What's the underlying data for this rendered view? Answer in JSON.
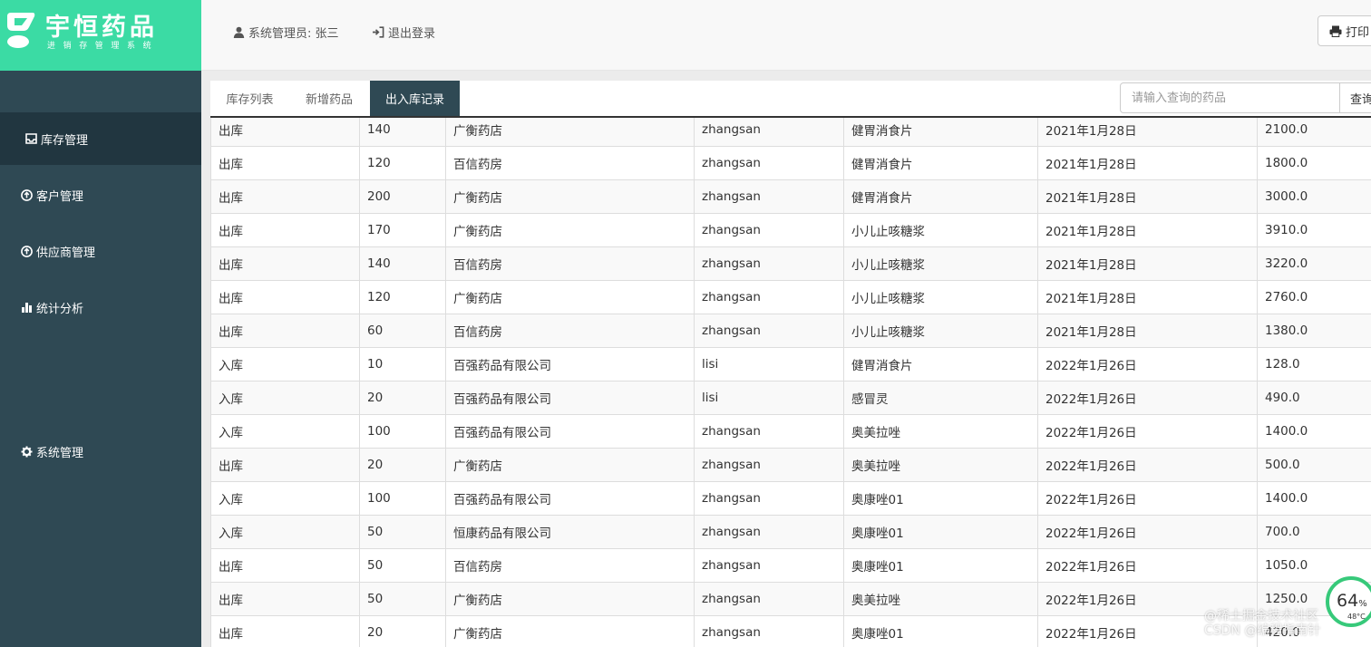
{
  "logo": {
    "title": "宇恒药品",
    "subtitle": "进销存管理系统"
  },
  "sidebar": {
    "items": [
      {
        "label": "库存管理",
        "icon": "inbox-icon",
        "active": true
      },
      {
        "label": "客户管理",
        "icon": "circle-arrow-icon"
      },
      {
        "label": "供应商管理",
        "icon": "circle-arrow-icon"
      },
      {
        "label": "统计分析",
        "icon": "bar-chart-icon"
      },
      {
        "label": "系统管理",
        "icon": "gear-icon"
      }
    ]
  },
  "header": {
    "user_label": "系统管理员: 张三",
    "logout_label": "退出登录",
    "print_label": "打印"
  },
  "tabs": [
    {
      "label": "库存列表"
    },
    {
      "label": "新增药品"
    },
    {
      "label": "出入库记录",
      "active": true
    }
  ],
  "search": {
    "placeholder": "请输入查询的药品",
    "button_label": "查询"
  },
  "table": {
    "rows": [
      [
        "出库",
        "140",
        "广衡药店",
        "zhangsan",
        "健胃消食片",
        "2021年1月28日",
        "2100.0"
      ],
      [
        "出库",
        "120",
        "百信药房",
        "zhangsan",
        "健胃消食片",
        "2021年1月28日",
        "1800.0"
      ],
      [
        "出库",
        "200",
        "广衡药店",
        "zhangsan",
        "健胃消食片",
        "2021年1月28日",
        "3000.0"
      ],
      [
        "出库",
        "170",
        "广衡药店",
        "zhangsan",
        "小儿止咳糖浆",
        "2021年1月28日",
        "3910.0"
      ],
      [
        "出库",
        "140",
        "百信药房",
        "zhangsan",
        "小儿止咳糖浆",
        "2021年1月28日",
        "3220.0"
      ],
      [
        "出库",
        "120",
        "广衡药店",
        "zhangsan",
        "小儿止咳糖浆",
        "2021年1月28日",
        "2760.0"
      ],
      [
        "出库",
        "60",
        "百信药房",
        "zhangsan",
        "小儿止咳糖浆",
        "2021年1月28日",
        "1380.0"
      ],
      [
        "入库",
        "10",
        "百强药品有限公司",
        "lisi",
        "健胃消食片",
        "2022年1月26日",
        "128.0"
      ],
      [
        "入库",
        "20",
        "百强药品有限公司",
        "lisi",
        "感冒灵",
        "2022年1月26日",
        "490.0"
      ],
      [
        "入库",
        "100",
        "百强药品有限公司",
        "zhangsan",
        "奥美拉唑",
        "2022年1月26日",
        "1400.0"
      ],
      [
        "出库",
        "20",
        "广衡药店",
        "zhangsan",
        "奥美拉唑",
        "2022年1月26日",
        "500.0"
      ],
      [
        "入库",
        "100",
        "百强药品有限公司",
        "zhangsan",
        "奥康唑01",
        "2022年1月26日",
        "1400.0"
      ],
      [
        "入库",
        "50",
        "恒康药品有限公司",
        "zhangsan",
        "奥康唑01",
        "2022年1月26日",
        "700.0"
      ],
      [
        "出库",
        "50",
        "百信药房",
        "zhangsan",
        "奥康唑01",
        "2022年1月26日",
        "1050.0"
      ],
      [
        "出库",
        "50",
        "广衡药店",
        "zhangsan",
        "奥美拉唑",
        "2022年1月26日",
        "1250.0"
      ],
      [
        "出库",
        "20",
        "广衡药店",
        "zhangsan",
        "奥康唑01",
        "2022年1月26日",
        "420.0"
      ]
    ]
  },
  "overlay": {
    "speed_percent": "64",
    "speed_unit": "%",
    "temperature": "48°C",
    "watermark_line1": "@稀土掘金技术社区",
    "watermark_line2": "CSDN @编程指南针"
  },
  "colors": {
    "sidebar": "#2f4954",
    "sidebar_active": "#213640",
    "logo_bg": "#3bdba4"
  }
}
